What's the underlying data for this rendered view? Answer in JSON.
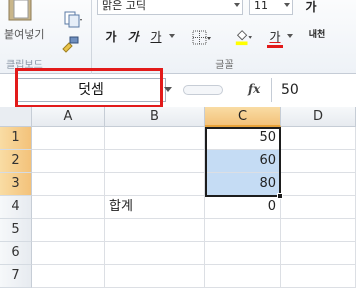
{
  "ribbon": {
    "clipboard": {
      "paste_label": "붙여넣기",
      "group_label": "클립보드"
    },
    "font": {
      "font_name": "맑은 고딕",
      "font_size": "11",
      "grow_label": "가",
      "bold_label": "가",
      "italic_label": "가",
      "underline_label": "가",
      "font_color_label": "가",
      "phonetic_label": "내천",
      "group_label": "글꼴"
    }
  },
  "name_box": {
    "value": "덧셈"
  },
  "formula_bar": {
    "fx_label": "fx",
    "value": "50"
  },
  "columns": [
    "A",
    "B",
    "C",
    "D"
  ],
  "rows": [
    "1",
    "2",
    "3",
    "4",
    "5",
    "6",
    "7"
  ],
  "cells": {
    "C1": "50",
    "C2": "60",
    "C3": "80",
    "B4": "합계",
    "C4": "0"
  },
  "colors": {
    "highlight": "#e21a1a",
    "selection_fill": "#c5dcf4",
    "header_selected": "#f3c27a"
  }
}
